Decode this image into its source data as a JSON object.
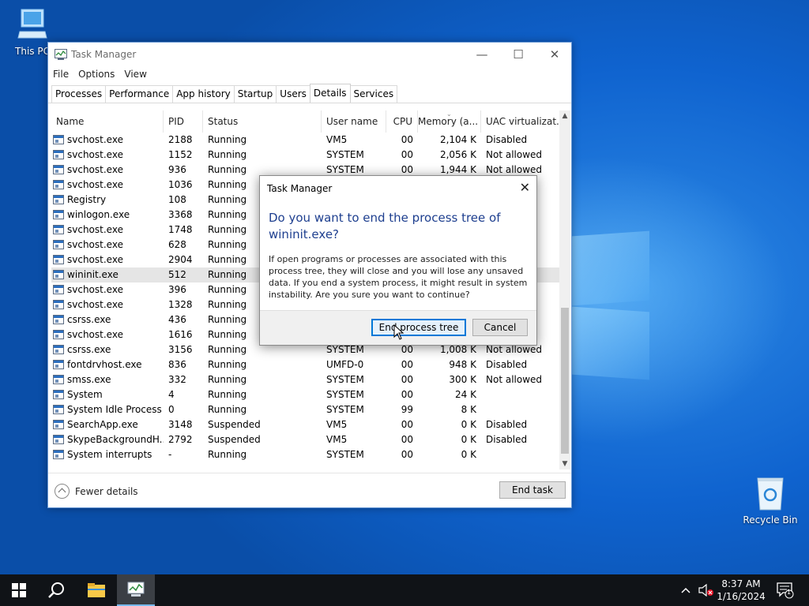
{
  "desktop": {
    "icons": [
      {
        "label": "This PC",
        "icon": "computer-icon"
      },
      {
        "label": "Recycle Bin",
        "icon": "recycle-bin-icon"
      }
    ],
    "accent": "#0f63cf"
  },
  "window": {
    "title": "Task Manager",
    "menu": [
      "File",
      "Options",
      "View"
    ],
    "tabs": [
      "Processes",
      "Performance",
      "App history",
      "Startup",
      "Users",
      "Details",
      "Services"
    ],
    "active_tab": "Details",
    "columns": [
      "Name",
      "PID",
      "Status",
      "User name",
      "CPU",
      "Memory (a...",
      "UAC virtualizat..."
    ],
    "rows": [
      {
        "name": "svchost.exe",
        "pid": "2188",
        "status": "Running",
        "user": "VM5",
        "cpu": "00",
        "mem": "2,104 K",
        "uac": "Disabled"
      },
      {
        "name": "svchost.exe",
        "pid": "1152",
        "status": "Running",
        "user": "SYSTEM",
        "cpu": "00",
        "mem": "2,056 K",
        "uac": "Not allowed"
      },
      {
        "name": "svchost.exe",
        "pid": "936",
        "status": "Running",
        "user": "SYSTEM",
        "cpu": "00",
        "mem": "1,944 K",
        "uac": "Not allowed"
      },
      {
        "name": "svchost.exe",
        "pid": "1036",
        "status": "Running",
        "user": "",
        "cpu": "",
        "mem": "",
        "uac": ""
      },
      {
        "name": "Registry",
        "pid": "108",
        "status": "Running",
        "user": "",
        "cpu": "",
        "mem": "",
        "uac": ""
      },
      {
        "name": "winlogon.exe",
        "pid": "3368",
        "status": "Running",
        "user": "",
        "cpu": "",
        "mem": "",
        "uac": ""
      },
      {
        "name": "svchost.exe",
        "pid": "1748",
        "status": "Running",
        "user": "",
        "cpu": "",
        "mem": "",
        "uac": ""
      },
      {
        "name": "svchost.exe",
        "pid": "628",
        "status": "Running",
        "user": "",
        "cpu": "",
        "mem": "",
        "uac": ""
      },
      {
        "name": "svchost.exe",
        "pid": "2904",
        "status": "Running",
        "user": "",
        "cpu": "",
        "mem": "",
        "uac": ""
      },
      {
        "name": "wininit.exe",
        "pid": "512",
        "status": "Running",
        "user": "",
        "cpu": "",
        "mem": "",
        "uac": "",
        "selected": true
      },
      {
        "name": "svchost.exe",
        "pid": "396",
        "status": "Running",
        "user": "",
        "cpu": "",
        "mem": "",
        "uac": ""
      },
      {
        "name": "svchost.exe",
        "pid": "1328",
        "status": "Running",
        "user": "",
        "cpu": "",
        "mem": "",
        "uac": ""
      },
      {
        "name": "csrss.exe",
        "pid": "436",
        "status": "Running",
        "user": "",
        "cpu": "",
        "mem": "",
        "uac": ""
      },
      {
        "name": "svchost.exe",
        "pid": "1616",
        "status": "Running",
        "user": "",
        "cpu": "",
        "mem": "",
        "uac": ""
      },
      {
        "name": "csrss.exe",
        "pid": "3156",
        "status": "Running",
        "user": "SYSTEM",
        "cpu": "00",
        "mem": "1,008 K",
        "uac": "Not allowed"
      },
      {
        "name": "fontdrvhost.exe",
        "pid": "836",
        "status": "Running",
        "user": "UMFD-0",
        "cpu": "00",
        "mem": "948 K",
        "uac": "Disabled"
      },
      {
        "name": "smss.exe",
        "pid": "332",
        "status": "Running",
        "user": "SYSTEM",
        "cpu": "00",
        "mem": "300 K",
        "uac": "Not allowed"
      },
      {
        "name": "System",
        "pid": "4",
        "status": "Running",
        "user": "SYSTEM",
        "cpu": "00",
        "mem": "24 K",
        "uac": ""
      },
      {
        "name": "System Idle Process",
        "pid": "0",
        "status": "Running",
        "user": "SYSTEM",
        "cpu": "99",
        "mem": "8 K",
        "uac": ""
      },
      {
        "name": "SearchApp.exe",
        "pid": "3148",
        "status": "Suspended",
        "user": "VM5",
        "cpu": "00",
        "mem": "0 K",
        "uac": "Disabled"
      },
      {
        "name": "SkypeBackgroundH...",
        "pid": "2792",
        "status": "Suspended",
        "user": "VM5",
        "cpu": "00",
        "mem": "0 K",
        "uac": "Disabled"
      },
      {
        "name": "System interrupts",
        "pid": "-",
        "status": "Running",
        "user": "SYSTEM",
        "cpu": "00",
        "mem": "0 K",
        "uac": ""
      }
    ],
    "fewer_details": "Fewer details",
    "end_task": "End task"
  },
  "dialog": {
    "title": "Task Manager",
    "heading": "Do you want to end the process tree of wininit.exe?",
    "message": "If open programs or processes are associated with this process tree, they will close and you will lose any unsaved data. If you end a system process, it might result in system instability. Are you sure you want to continue?",
    "confirm": "End process tree",
    "cancel": "Cancel"
  },
  "taskbar": {
    "time": "8:37 AM",
    "date": "1/16/2024",
    "notification_count": "1"
  }
}
